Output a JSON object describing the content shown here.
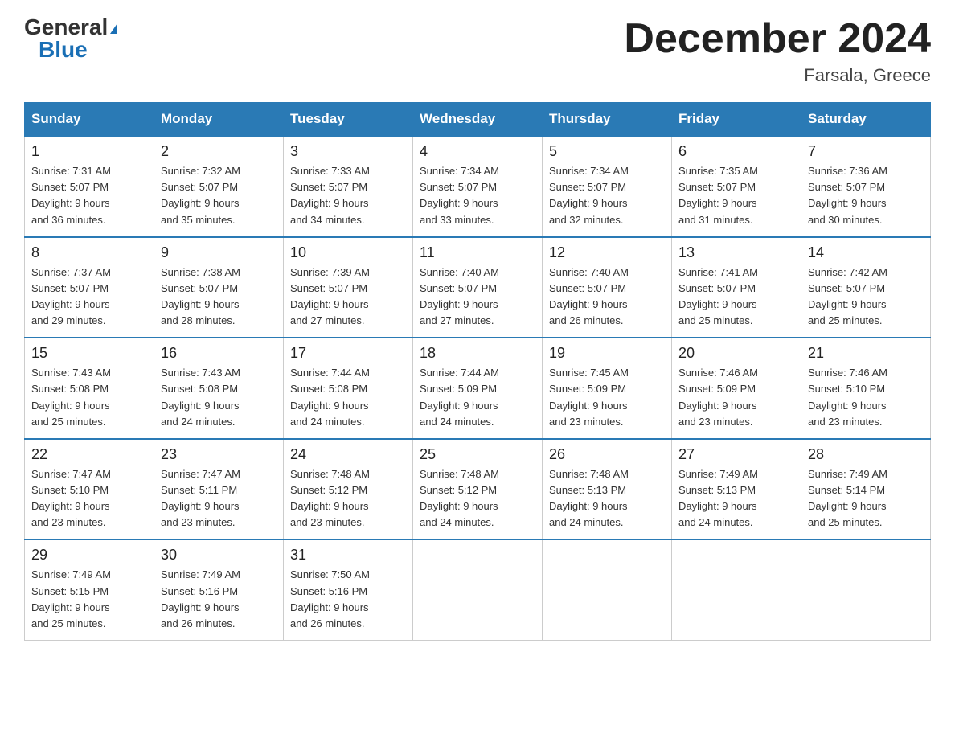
{
  "logo": {
    "general": "General",
    "blue": "Blue",
    "triangle": true
  },
  "title": "December 2024",
  "location": "Farsala, Greece",
  "days_of_week": [
    "Sunday",
    "Monday",
    "Tuesday",
    "Wednesday",
    "Thursday",
    "Friday",
    "Saturday"
  ],
  "weeks": [
    [
      {
        "day": "1",
        "sunrise": "7:31 AM",
        "sunset": "5:07 PM",
        "daylight": "9 hours and 36 minutes."
      },
      {
        "day": "2",
        "sunrise": "7:32 AM",
        "sunset": "5:07 PM",
        "daylight": "9 hours and 35 minutes."
      },
      {
        "day": "3",
        "sunrise": "7:33 AM",
        "sunset": "5:07 PM",
        "daylight": "9 hours and 34 minutes."
      },
      {
        "day": "4",
        "sunrise": "7:34 AM",
        "sunset": "5:07 PM",
        "daylight": "9 hours and 33 minutes."
      },
      {
        "day": "5",
        "sunrise": "7:34 AM",
        "sunset": "5:07 PM",
        "daylight": "9 hours and 32 minutes."
      },
      {
        "day": "6",
        "sunrise": "7:35 AM",
        "sunset": "5:07 PM",
        "daylight": "9 hours and 31 minutes."
      },
      {
        "day": "7",
        "sunrise": "7:36 AM",
        "sunset": "5:07 PM",
        "daylight": "9 hours and 30 minutes."
      }
    ],
    [
      {
        "day": "8",
        "sunrise": "7:37 AM",
        "sunset": "5:07 PM",
        "daylight": "9 hours and 29 minutes."
      },
      {
        "day": "9",
        "sunrise": "7:38 AM",
        "sunset": "5:07 PM",
        "daylight": "9 hours and 28 minutes."
      },
      {
        "day": "10",
        "sunrise": "7:39 AM",
        "sunset": "5:07 PM",
        "daylight": "9 hours and 27 minutes."
      },
      {
        "day": "11",
        "sunrise": "7:40 AM",
        "sunset": "5:07 PM",
        "daylight": "9 hours and 27 minutes."
      },
      {
        "day": "12",
        "sunrise": "7:40 AM",
        "sunset": "5:07 PM",
        "daylight": "9 hours and 26 minutes."
      },
      {
        "day": "13",
        "sunrise": "7:41 AM",
        "sunset": "5:07 PM",
        "daylight": "9 hours and 25 minutes."
      },
      {
        "day": "14",
        "sunrise": "7:42 AM",
        "sunset": "5:07 PM",
        "daylight": "9 hours and 25 minutes."
      }
    ],
    [
      {
        "day": "15",
        "sunrise": "7:43 AM",
        "sunset": "5:08 PM",
        "daylight": "9 hours and 25 minutes."
      },
      {
        "day": "16",
        "sunrise": "7:43 AM",
        "sunset": "5:08 PM",
        "daylight": "9 hours and 24 minutes."
      },
      {
        "day": "17",
        "sunrise": "7:44 AM",
        "sunset": "5:08 PM",
        "daylight": "9 hours and 24 minutes."
      },
      {
        "day": "18",
        "sunrise": "7:44 AM",
        "sunset": "5:09 PM",
        "daylight": "9 hours and 24 minutes."
      },
      {
        "day": "19",
        "sunrise": "7:45 AM",
        "sunset": "5:09 PM",
        "daylight": "9 hours and 23 minutes."
      },
      {
        "day": "20",
        "sunrise": "7:46 AM",
        "sunset": "5:09 PM",
        "daylight": "9 hours and 23 minutes."
      },
      {
        "day": "21",
        "sunrise": "7:46 AM",
        "sunset": "5:10 PM",
        "daylight": "9 hours and 23 minutes."
      }
    ],
    [
      {
        "day": "22",
        "sunrise": "7:47 AM",
        "sunset": "5:10 PM",
        "daylight": "9 hours and 23 minutes."
      },
      {
        "day": "23",
        "sunrise": "7:47 AM",
        "sunset": "5:11 PM",
        "daylight": "9 hours and 23 minutes."
      },
      {
        "day": "24",
        "sunrise": "7:48 AM",
        "sunset": "5:12 PM",
        "daylight": "9 hours and 23 minutes."
      },
      {
        "day": "25",
        "sunrise": "7:48 AM",
        "sunset": "5:12 PM",
        "daylight": "9 hours and 24 minutes."
      },
      {
        "day": "26",
        "sunrise": "7:48 AM",
        "sunset": "5:13 PM",
        "daylight": "9 hours and 24 minutes."
      },
      {
        "day": "27",
        "sunrise": "7:49 AM",
        "sunset": "5:13 PM",
        "daylight": "9 hours and 24 minutes."
      },
      {
        "day": "28",
        "sunrise": "7:49 AM",
        "sunset": "5:14 PM",
        "daylight": "9 hours and 25 minutes."
      }
    ],
    [
      {
        "day": "29",
        "sunrise": "7:49 AM",
        "sunset": "5:15 PM",
        "daylight": "9 hours and 25 minutes."
      },
      {
        "day": "30",
        "sunrise": "7:49 AM",
        "sunset": "5:16 PM",
        "daylight": "9 hours and 26 minutes."
      },
      {
        "day": "31",
        "sunrise": "7:50 AM",
        "sunset": "5:16 PM",
        "daylight": "9 hours and 26 minutes."
      },
      null,
      null,
      null,
      null
    ]
  ],
  "labels": {
    "sunrise": "Sunrise:",
    "sunset": "Sunset:",
    "daylight": "Daylight:"
  }
}
